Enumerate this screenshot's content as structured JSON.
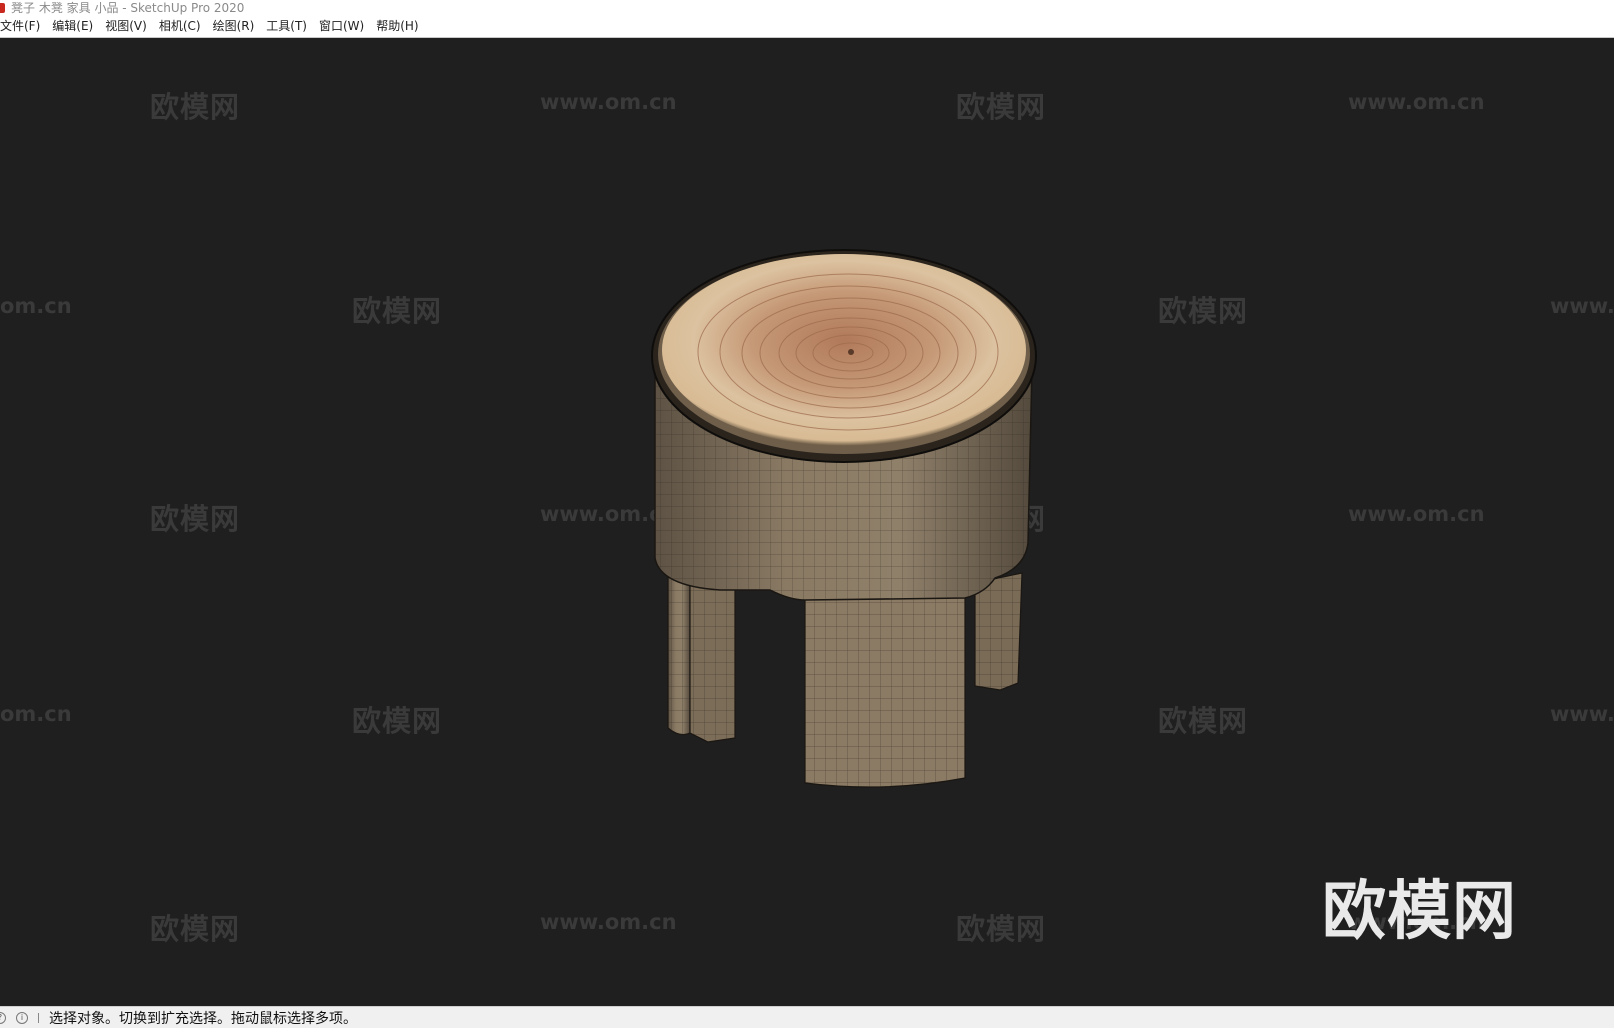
{
  "window": {
    "title": "凳子 木凳 家具 小品 - SketchUp Pro 2020"
  },
  "menu": {
    "items": [
      {
        "label": "文件(F)"
      },
      {
        "label": "编辑(E)"
      },
      {
        "label": "视图(V)"
      },
      {
        "label": "相机(C)"
      },
      {
        "label": "绘图(R)"
      },
      {
        "label": "工具(T)"
      },
      {
        "label": "窗口(W)"
      },
      {
        "label": "帮助(H)"
      }
    ]
  },
  "viewport": {
    "background_color": "#1f1f1f",
    "watermark_text_cn": "欧模网",
    "watermark_text_url": "www.om.cn",
    "watermark_partial_left": "om.cn",
    "watermark_partial_right": "www.",
    "watermark_partial_center": "www.om.cn",
    "big_logo_text": "欧模网",
    "model": "wooden-stump-stool"
  },
  "status": {
    "icons": [
      "geo-location-icon",
      "info-icon"
    ],
    "message": "选择对象。切换到扩充选择。拖动鼠标选择多项。"
  }
}
